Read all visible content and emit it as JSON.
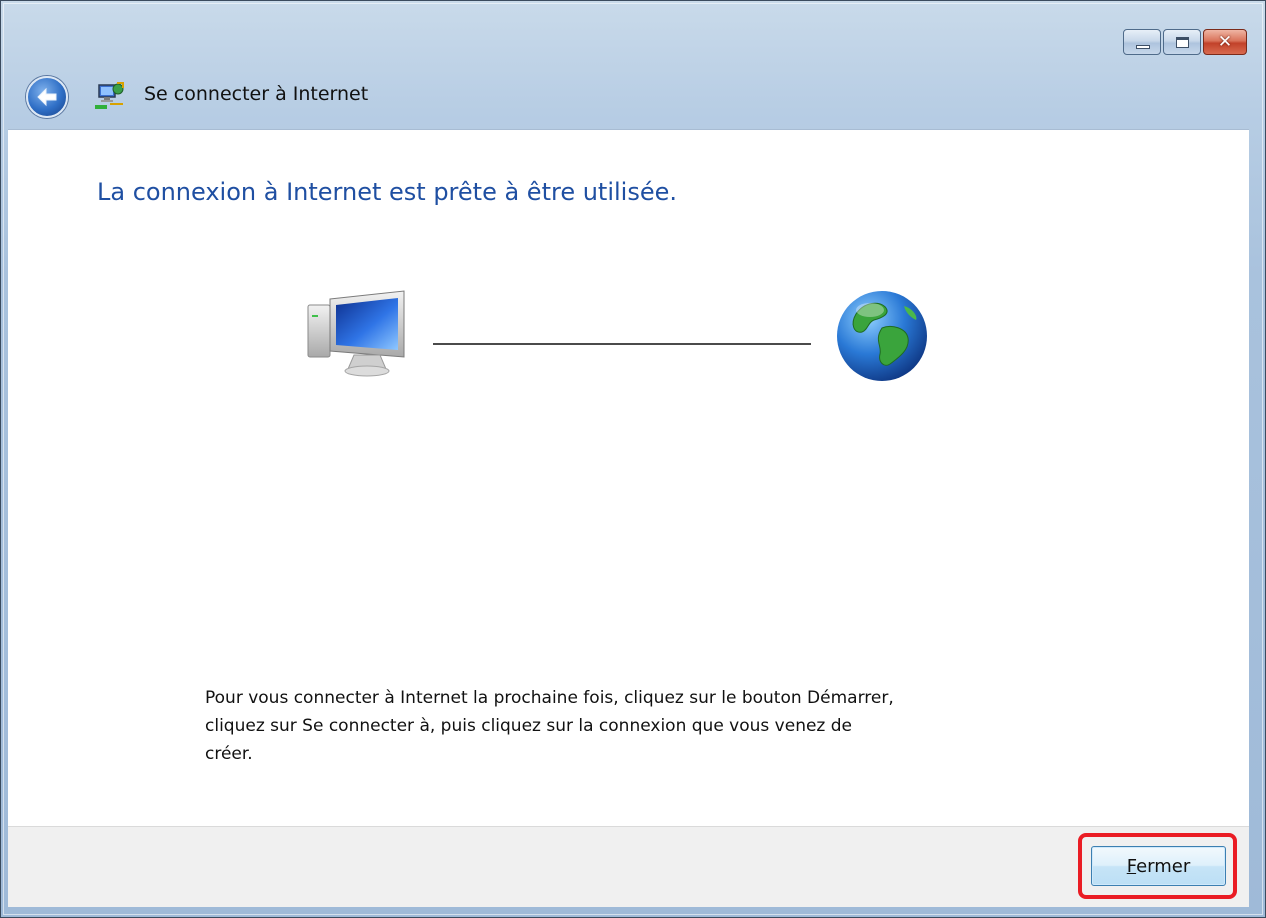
{
  "window": {
    "title": "Se connecter à Internet",
    "caption_buttons": [
      "minimize",
      "maximize",
      "close"
    ]
  },
  "header": {
    "back_icon": "back-arrow-icon",
    "app_icon": "network-connection-icon"
  },
  "main": {
    "heading": "La connexion à Internet est prête à être utilisée.",
    "illustration": {
      "left_icon": "computer-icon",
      "right_icon": "globe-icon"
    },
    "instructions": "Pour vous connecter à Internet la prochaine fois, cliquez sur le bouton Démarrer, cliquez sur Se connecter à, puis cliquez sur la connexion que vous venez de créer."
  },
  "footer": {
    "close_label": "Fermer",
    "highlight_color": "#ea1c24"
  },
  "colors": {
    "heading": "#1f4fa2",
    "titlebar": "#b7cde4"
  }
}
